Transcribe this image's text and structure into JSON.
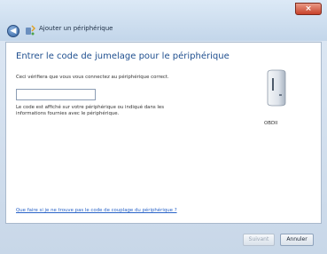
{
  "window": {
    "title": "Ajouter un périphérique",
    "close_label": "×"
  },
  "page": {
    "heading": "Entrer le code de jumelage pour le périphérique",
    "subtitle": "Ceci vérifiera que vous vous connectez au périphérique correct.",
    "code_input_value": "",
    "help_line_1": "Le code est affiché sur votre périphérique ou indiqué dans les",
    "help_line_2": "informations fournies avec le périphérique.",
    "device_name": "OBDII",
    "help_link": "Que faire si je ne trouve pas le code de couplage du périphérique ?"
  },
  "footer": {
    "next_label": "Suivant",
    "cancel_label": "Annuler"
  },
  "icons": {
    "back": "back-arrow-icon",
    "wizard": "bluetooth-device-icon",
    "device": "device-icon"
  }
}
